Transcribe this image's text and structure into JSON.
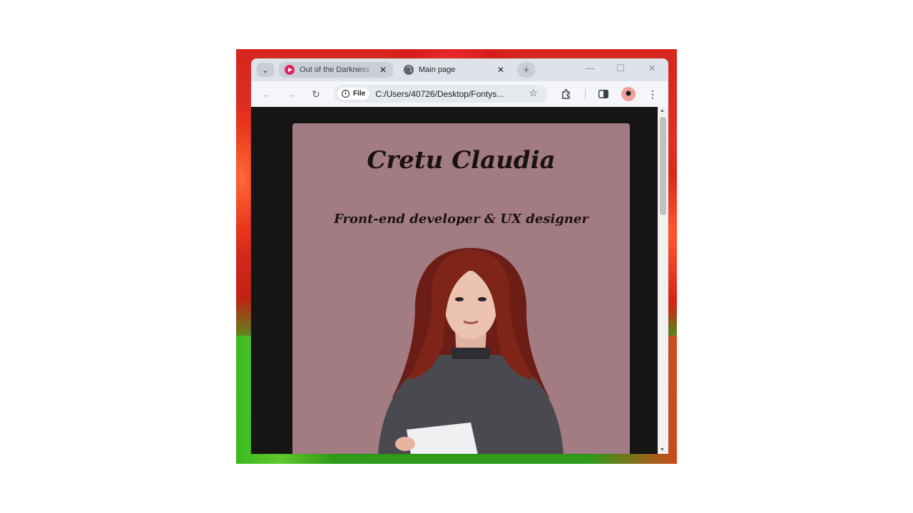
{
  "browser": {
    "tabs": [
      {
        "title": "Out of the Darkness",
        "icon": "play-icon",
        "active": false
      },
      {
        "title": "Main page",
        "icon": "globe-icon",
        "active": true
      }
    ],
    "address_chip": "File",
    "url": "C:/Users/40726/Desktop/Fontys...",
    "colors": {
      "frame": "#dee3ea",
      "toolbar": "#f4f6f9"
    }
  },
  "page": {
    "name": "Cretu Claudia",
    "role": "Front-end developer & UX designer",
    "colors": {
      "background": "#171415",
      "card": "#a37b83",
      "text": "#1a1212"
    }
  }
}
